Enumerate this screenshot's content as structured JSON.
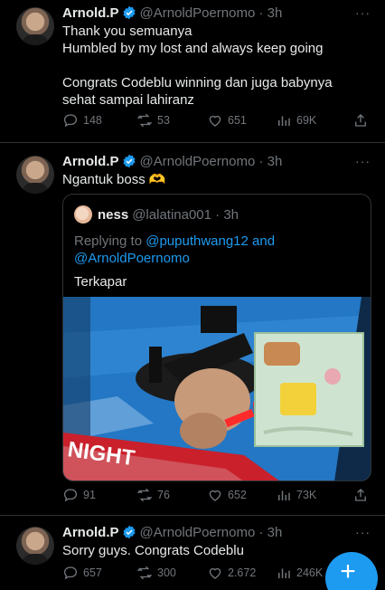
{
  "tweets": [
    {
      "name": "Arnold.P",
      "handle_time": "@ArnoldPoernomo · 3h",
      "lines": [
        "Thank you semuanya",
        "Humbled by my lost and always keep going",
        "",
        "Congrats Codeblu winning dan juga babynya",
        "sehat sampai lahiranz"
      ],
      "stats": {
        "replies": "148",
        "retweets": "53",
        "likes": "651",
        "views": "69K"
      }
    },
    {
      "name": "Arnold.P",
      "handle_time": "@ArnoldPoernomo · 3h",
      "text": "Ngantuk boss 🫶",
      "quote": {
        "name": "ness",
        "handle_time": "@lalatina001 · 3h",
        "replying_prefix": "Replying to ",
        "replying_to_1": "@puputhwang12",
        "replying_and": " and",
        "replying_to_2": "@ArnoldPoernomo",
        "text": "Terkapar",
        "media_text": "NIGHT"
      },
      "stats": {
        "replies": "91",
        "retweets": "76",
        "likes": "652",
        "views": "73K"
      }
    },
    {
      "name": "Arnold.P",
      "handle_time": "@ArnoldPoernomo · 3h",
      "text": "Sorry guys. Congrats Codeblu",
      "stats": {
        "replies": "657",
        "retweets": "300",
        "likes": "2.672",
        "views": "246K"
      }
    }
  ],
  "more_label": "···",
  "compose_label": "+",
  "colors": {
    "accent": "#1d9bf0",
    "muted": "#71767b",
    "text": "#e7e9ea",
    "background": "#000000"
  },
  "icons": [
    "verified-badge-icon",
    "reply-icon",
    "retweet-icon",
    "like-icon",
    "views-icon",
    "share-icon",
    "more-icon",
    "compose-icon"
  ]
}
